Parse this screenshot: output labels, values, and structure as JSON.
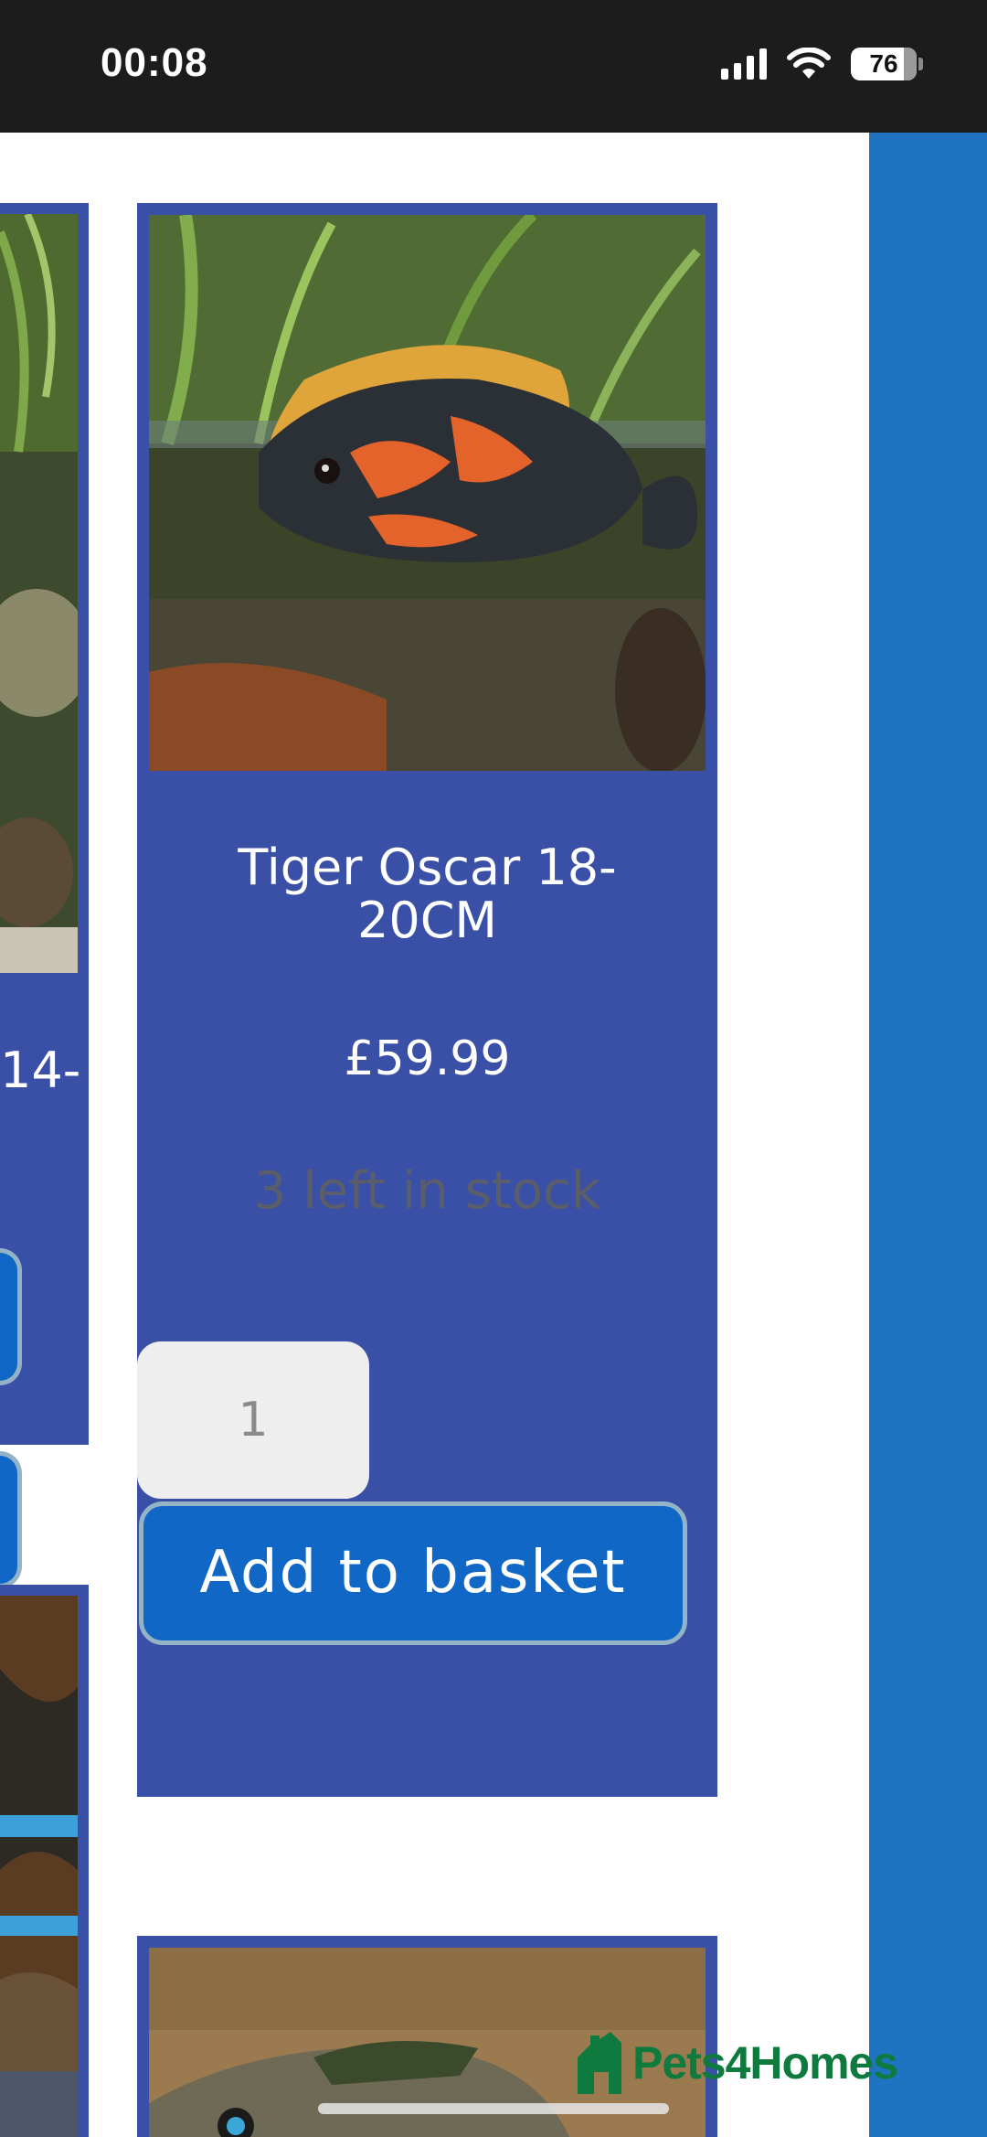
{
  "status_bar": {
    "time": "00:08",
    "battery": "76"
  },
  "products": {
    "left_partial_title": "14-",
    "main": {
      "title": "Tiger Oscar 18-20CM",
      "price": "£59.99",
      "stock": "3 left in stock",
      "quantity": "1",
      "add_to_basket_label": "Add to basket"
    }
  },
  "watermark": {
    "brand": "Pets4Homes"
  },
  "colors": {
    "card_bg": "#3a4fa6",
    "button_bg": "#1067c6",
    "sidebar": "#2073c0",
    "brand_green": "#0f7a3d"
  },
  "icons": [
    "signal-icon",
    "wifi-icon",
    "battery-icon",
    "pets4homes-logo-icon"
  ]
}
